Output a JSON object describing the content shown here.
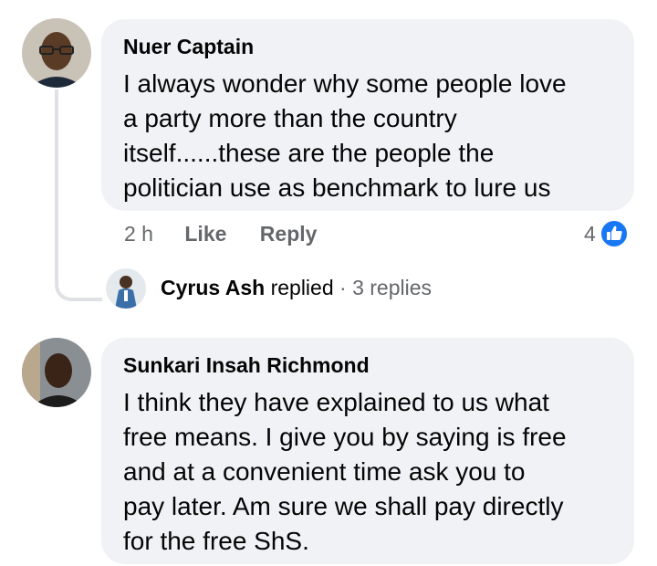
{
  "comments": [
    {
      "author": "Nuer Captain",
      "text": "I always wonder why some people love\na party more than the country\nitself......these are the people the\npolitician use as benchmark to lure us",
      "time": "2 h",
      "like_label": "Like",
      "reply_label": "Reply",
      "reaction_count": "4",
      "reaction_icon": "like-thumb-icon",
      "reply_summary": {
        "author": "Cyrus Ash",
        "verb": "replied",
        "separator": "·",
        "count": "3 replies"
      }
    },
    {
      "author": "Sunkari Insah Richmond",
      "text": "I think they have explained to us what\nfree means. I give you by saying is free\nand at a convenient time ask you to\npay later. Am sure we shall pay directly\nfor the free ShS."
    }
  ],
  "colors": {
    "bubble": "#f0f2f5",
    "secondary_text": "#65676b",
    "like_blue": "#1877f2"
  }
}
